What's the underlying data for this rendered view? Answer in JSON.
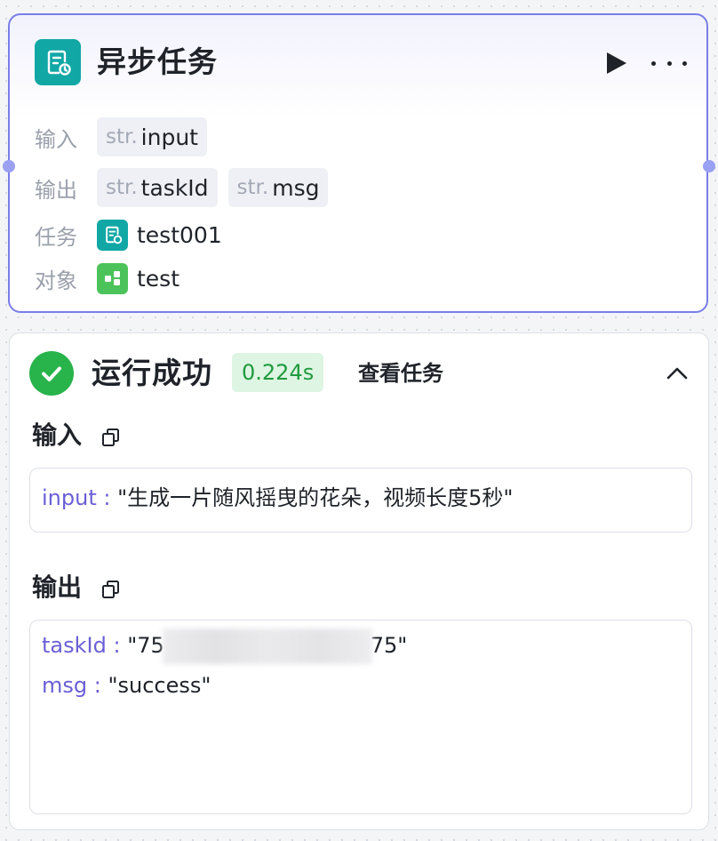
{
  "node": {
    "title": "异步任务",
    "icon": "async-task-icon",
    "accent_color": "#7a7ee8",
    "inputs_label": "输入",
    "inputs": [
      {
        "type": "str.",
        "name": "input"
      }
    ],
    "outputs_label": "输出",
    "outputs": [
      {
        "type": "str.",
        "name": "taskId"
      },
      {
        "type": "str.",
        "name": "msg"
      }
    ],
    "task_label": "任务",
    "task_value": "test001",
    "task_icon": "async-task-icon",
    "object_label": "对象",
    "object_value": "test",
    "object_icon": "object-model-icon"
  },
  "result": {
    "status": "运行成功",
    "status_icon": "check-circle-icon",
    "duration": "0.224s",
    "view_task": "查看任务",
    "input_section_title": "输入",
    "input_lines": [
      {
        "key": "input",
        "sep": " : ",
        "value": "\"生成一片随风摇曳的花朵，视频长度5秒\""
      }
    ],
    "output_section_title": "输出",
    "output_lines": [
      {
        "key": "taskId",
        "sep": " : ",
        "value_prefix": "\"75",
        "value_suffix": "75\""
      },
      {
        "key": "msg",
        "sep": " : ",
        "value": "\"success\""
      }
    ],
    "success_color": "#28b34b"
  }
}
